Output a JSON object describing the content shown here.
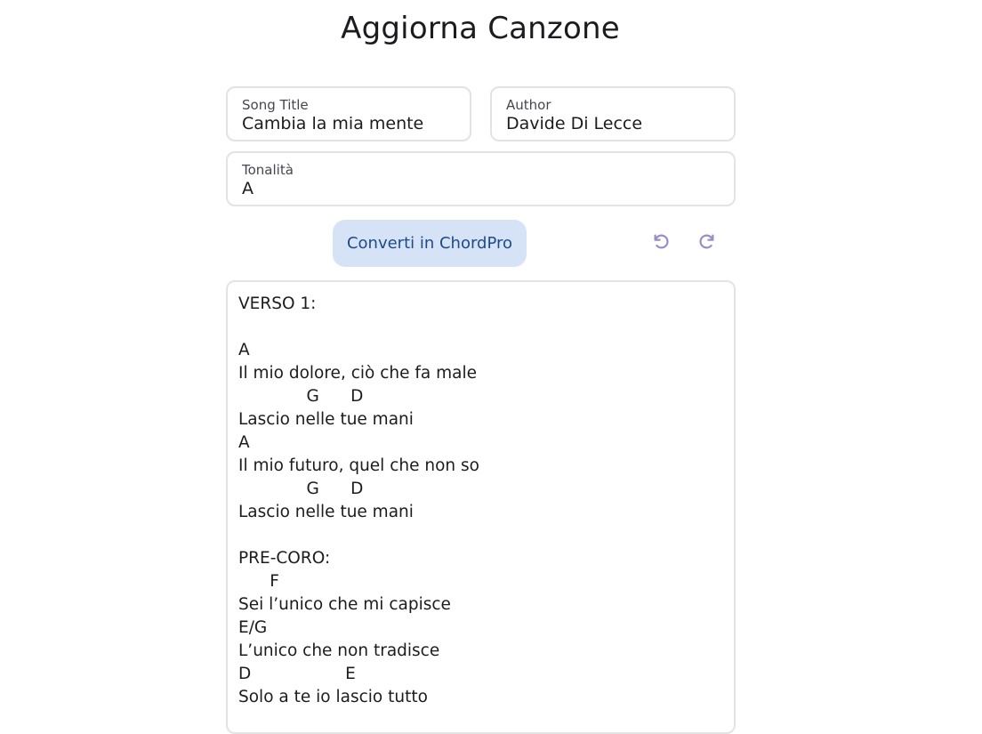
{
  "page": {
    "title": "Aggiorna Canzone"
  },
  "form": {
    "song_title": {
      "label": "Song Title",
      "value": "Cambia la mia mente"
    },
    "author": {
      "label": "Author",
      "value": "Davide Di Lecce"
    },
    "key": {
      "label": "Tonalità",
      "value": "A"
    }
  },
  "toolbar": {
    "convert_label": "Converti in ChordPro",
    "undo_icon": "undo-icon",
    "redo_icon": "redo-icon",
    "icon_color": "#9a8cc4"
  },
  "editor": {
    "content": "VERSO 1:\n\nA\nIl mio dolore, ciò che fa male\n             G      D\nLascio nelle tue mani\nA\nIl mio futuro, quel che non so\n             G      D\nLascio nelle tue mani\n\nPRE-CORO:\n      F\nSei l’unico che mi capisce\nE/G\nL’unico che non tradisce\nD                  E\nSolo a te io lascio tutto"
  },
  "colors": {
    "accent_button_bg": "#d6e3f7",
    "accent_button_text": "#1e4a8a",
    "field_border": "#e3e3e3"
  }
}
